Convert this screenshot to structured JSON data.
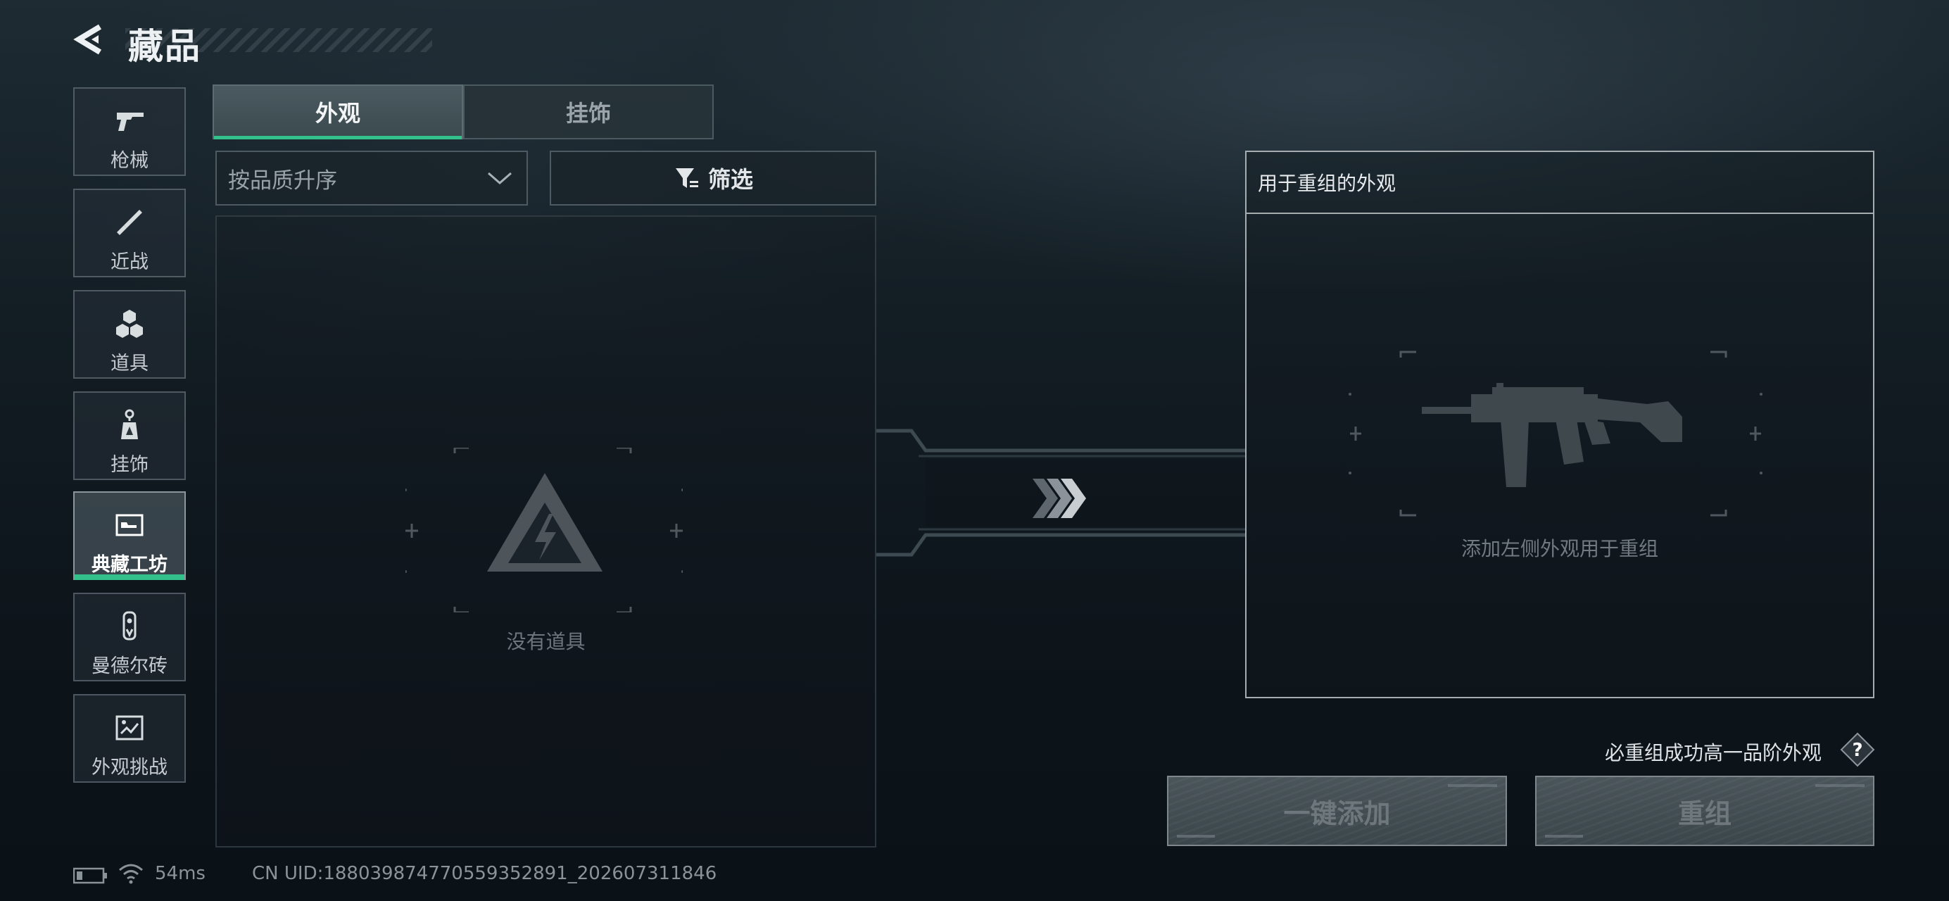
{
  "header": {
    "title": "藏品"
  },
  "sidebar": {
    "items": [
      {
        "label": "枪械",
        "icon": "gun-icon"
      },
      {
        "label": "近战",
        "icon": "knife-icon"
      },
      {
        "label": "道具",
        "icon": "grenades-icon"
      },
      {
        "label": "挂饰",
        "icon": "charm-icon"
      },
      {
        "label": "典藏工坊",
        "icon": "workshop-icon",
        "active": true
      },
      {
        "label": "曼德尔砖",
        "icon": "mandel-brick-icon"
      },
      {
        "label": "外观挑战",
        "icon": "challenge-map-icon"
      }
    ]
  },
  "tabs": [
    {
      "label": "外观",
      "selected": true
    },
    {
      "label": "挂饰",
      "selected": false
    }
  ],
  "sort": {
    "value": "按品质升序"
  },
  "filter": {
    "label": "筛选"
  },
  "inventory": {
    "empty_text": "没有道具"
  },
  "recombine": {
    "title": "用于重组的外观",
    "hint": "添加左侧外观用于重组"
  },
  "guarantee": {
    "text": "必重组成功高一品阶外观",
    "help_glyph": "?"
  },
  "buttons": {
    "add_all": "一键添加",
    "recombine": "重组"
  },
  "status": {
    "ping": "54ms",
    "uid": "CN UID:18803987477055935289​1_202607311846"
  },
  "colors": {
    "accent_green": "#34c08a"
  }
}
